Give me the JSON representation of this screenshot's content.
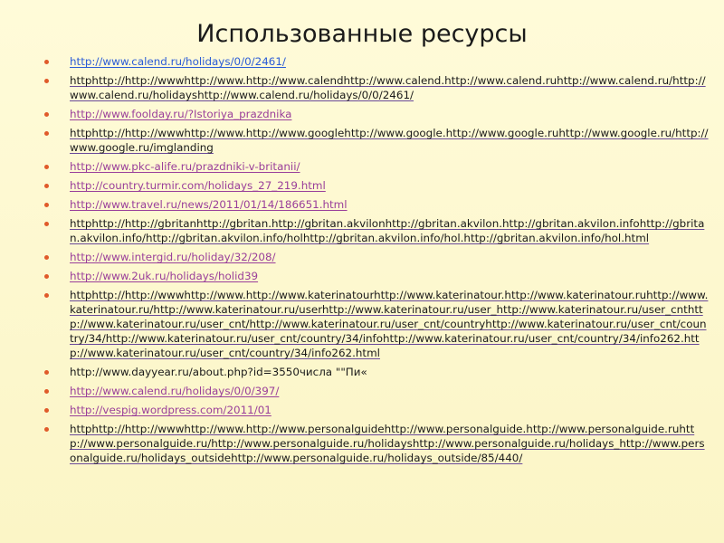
{
  "title": "Использованные ресурсы",
  "colors": {
    "background": "#fdf8cf",
    "bullet": "#e05a2a",
    "link": "#2a5bd7",
    "visited": "#9a3f9a",
    "text": "#1a1a1a"
  },
  "items": [
    {
      "text": "http://www.calend.ru/holidays/0/0/2461/",
      "style": "blue"
    },
    {
      "text": "httphttp://http://wwwhttp://www.http://www.calendhttp://www.calend.http://www.calend.ruhttp://www.calend.ru/http://www.calend.ru/holidayshttp://www.calend.ru/holidays/0/0/2461/",
      "style": "mixed"
    },
    {
      "text": "http://www.foolday.ru/?Istoriya_prazdnika",
      "style": "purple"
    },
    {
      "text": "httphttp://http://wwwhttp://www.http://www.googlehttp://www.google.http://www.google.ruhttp://www.google.ru/http://www.google.ru/imglanding",
      "style": "mixed"
    },
    {
      "text": "http://www.pkc-alife.ru/prazdniki-v-britanii/",
      "style": "purple"
    },
    {
      "text": "http://country.turmir.com/holidays_27_219.html",
      "style": "purple"
    },
    {
      "text": "http://www.travel.ru/news/2011/01/14/186651.html",
      "style": "purple"
    },
    {
      "text": "httphttp://http://gbritanhttp://gbritan.http://gbritan.akvilonhttp://gbritan.akvilon.http://gbritan.akvilon.infohttp://gbritan.akvilon.info/http://gbritan.akvilon.info/holhttp://gbritan.akvilon.info/hol.http://gbritan.akvilon.info/hol.html",
      "style": "mixed"
    },
    {
      "text": "http://www.intergid.ru/holiday/32/208/",
      "style": "purple"
    },
    {
      "text": "http://www.2uk.ru/holidays/holid39",
      "style": "purple"
    },
    {
      "text": "httphttp://http://wwwhttp://www.http://www.katerinatourhttp://www.katerinatour.http://www.katerinatour.ruhttp://www.katerinatour.ru/http://www.katerinatour.ru/userhttp://www.katerinatour.ru/user_http://www.katerinatour.ru/user_cnthttp://www.katerinatour.ru/user_cnt/http://www.katerinatour.ru/user_cnt/countryhttp://www.katerinatour.ru/user_cnt/country/34/http://www.katerinatour.ru/user_cnt/country/34/infohttp://www.katerinatour.ru/user_cnt/country/34/info262.http://www.katerinatour.ru/user_cnt/country/34/info262.html",
      "style": "mixed"
    },
    {
      "text": "http://www.dayyear.ru/about.php?id=3550числа \"\"Пи«",
      "style": "plain"
    },
    {
      "text": "http://www.calend.ru/holidays/0/0/397/",
      "style": "purple"
    },
    {
      "text": "http://vespig.wordpress.com/2011/01",
      "style": "purple"
    },
    {
      "text": "httphttp://http://wwwhttp://www.http://www.personalguidehttp://www.personalguide.http://www.personalguide.ruhttp://www.personalguide.ru/http://www.personalguide.ru/holidayshttp://www.personalguide.ru/holidays_http://www.personalguide.ru/holidays_outsidehttp://www.personalguide.ru/holidays_outside/85/440/",
      "style": "mixed"
    }
  ]
}
